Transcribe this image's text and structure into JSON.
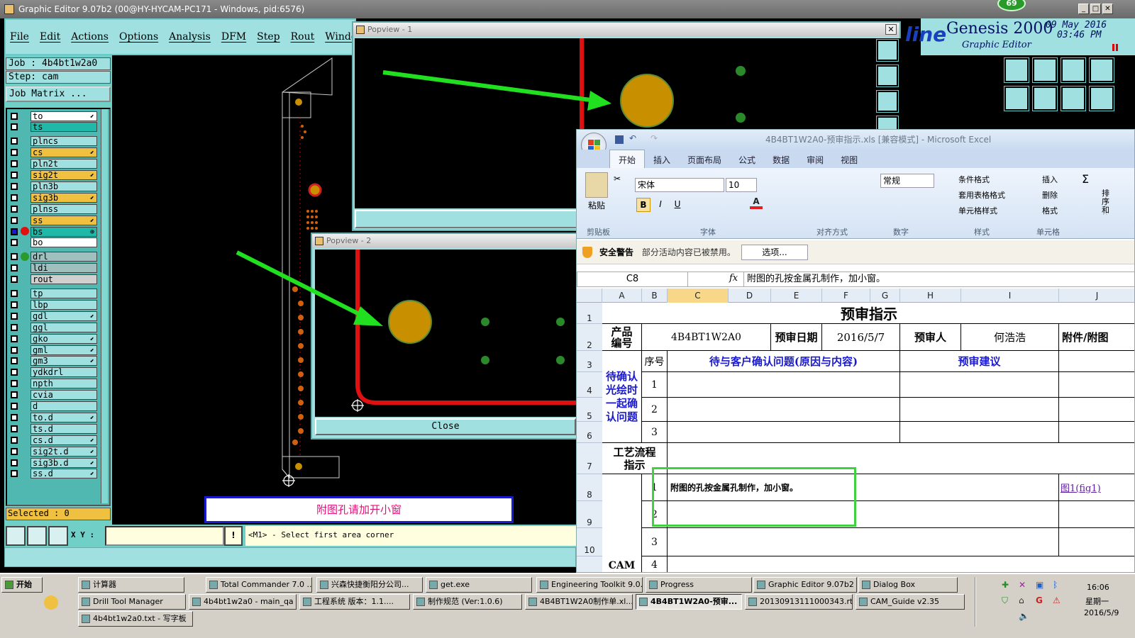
{
  "ge_window": {
    "title": "Graphic Editor 9.07b2 (00@HY-HYCAM-PC171 - Windows, pid:6576)",
    "badge": "69"
  },
  "menu": [
    "File",
    "Edit",
    "Actions",
    "Options",
    "Analysis",
    "DFM",
    "Step",
    "Rout",
    "Windows"
  ],
  "genesis": {
    "brand": "line",
    "product": "Genesis 2000",
    "subtitle": "Graphic Editor",
    "date": "09 May 2016",
    "time": "03:46 PM"
  },
  "job": {
    "job_label": "Job : 4b4bt1w2a0",
    "step_label": "Step: cam",
    "matrix_label": "Job Matrix ..."
  },
  "layers": [
    {
      "name": "to",
      "color": "#ffffff",
      "mark": "⬋"
    },
    {
      "name": "ts",
      "color": "#20b8a8",
      "mark": ""
    },
    {
      "name": "plncs",
      "color": "#a0e0e0",
      "mark": ""
    },
    {
      "name": "cs",
      "color": "#f0c040",
      "mark": "⬋"
    },
    {
      "name": "pln2t",
      "color": "#a0e0e0",
      "mark": ""
    },
    {
      "name": "sig2t",
      "color": "#f0c040",
      "mark": "⬋"
    },
    {
      "name": "pln3b",
      "color": "#a0e0e0",
      "mark": ""
    },
    {
      "name": "sig3b",
      "color": "#f0c040",
      "mark": "⬋"
    },
    {
      "name": "plnss",
      "color": "#a0e0e0",
      "mark": ""
    },
    {
      "name": "ss",
      "color": "#f0c040",
      "mark": "⬋"
    },
    {
      "name": "bs",
      "color": "#20b8a8",
      "mark": "⊕"
    },
    {
      "name": "bo",
      "color": "#ffffff",
      "mark": ""
    },
    {
      "name": "drl",
      "color": "#a0c0c0",
      "mark": ""
    },
    {
      "name": "ldi",
      "color": "#a0c0c0",
      "mark": ""
    },
    {
      "name": "rout",
      "color": "#d0d0d0",
      "mark": ""
    },
    {
      "name": "tp",
      "color": "#a0e0e0",
      "mark": ""
    },
    {
      "name": "lbp",
      "color": "#a0e0e0",
      "mark": ""
    },
    {
      "name": "gdl",
      "color": "#a0e0e0",
      "mark": "⬋"
    },
    {
      "name": "ggl",
      "color": "#a0e0e0",
      "mark": ""
    },
    {
      "name": "gko",
      "color": "#a0e0e0",
      "mark": "⬋"
    },
    {
      "name": "gml",
      "color": "#a0e0e0",
      "mark": "⬋"
    },
    {
      "name": "gm3",
      "color": "#a0e0e0",
      "mark": "⬋"
    },
    {
      "name": "ydkdrl",
      "color": "#a0e0e0",
      "mark": ""
    },
    {
      "name": "npth",
      "color": "#a0e0e0",
      "mark": ""
    },
    {
      "name": "cvia",
      "color": "#a0e0e0",
      "mark": ""
    },
    {
      "name": "d",
      "color": "#a0e0e0",
      "mark": ""
    },
    {
      "name": "to.d",
      "color": "#a0e0e0",
      "mark": "⬋"
    },
    {
      "name": "ts.d",
      "color": "#a0e0e0",
      "mark": ""
    },
    {
      "name": "cs.d",
      "color": "#a0e0e0",
      "mark": "⬋"
    },
    {
      "name": "sig2t.d",
      "color": "#a0e0e0",
      "mark": "⬋"
    },
    {
      "name": "sig3b.d",
      "color": "#a0e0e0",
      "mark": "⬋"
    },
    {
      "name": "ss.d",
      "color": "#a0e0e0",
      "mark": "⬋"
    }
  ],
  "selected_label": "Selected : 0",
  "popview1": {
    "title": "Popview - 1"
  },
  "popview2": {
    "title": "Popview - 2",
    "close_label": "Close"
  },
  "annotation_text": "附图孔请加开小窗",
  "status": {
    "xy_label": "X Y :",
    "message": "<M1> - Select first area corner"
  },
  "excel": {
    "title": "4B4BT1W2A0-预审指示.xls  [兼容模式] - Microsoft Excel",
    "tabs": [
      "开始",
      "插入",
      "页面布局",
      "公式",
      "数据",
      "审阅",
      "视图"
    ],
    "clipboard": {
      "paste": "粘贴",
      "group": "剪贴板"
    },
    "font": {
      "name": "宋体",
      "size": "10",
      "group": "字体"
    },
    "align_group": "对齐方式",
    "number": {
      "format": "常规",
      "group": "数字"
    },
    "styles": {
      "items": [
        "条件格式",
        "套用表格格式",
        "单元格样式"
      ],
      "group": "样式"
    },
    "cells_grp": {
      "items": [
        "插入",
        "删除",
        "格式"
      ],
      "group": "单元格"
    },
    "editing": {
      "label": "排序和筛选"
    },
    "security": {
      "title": "安全警告",
      "text": "部分活动内容已被禁用。",
      "button": "选项..."
    },
    "namebox": "C8",
    "formula": "附图的孔按金属孔制作，加小窗。",
    "columns": [
      "A",
      "B",
      "C",
      "D",
      "E",
      "F",
      "G",
      "H",
      "I",
      "J"
    ],
    "rows": [
      "1",
      "2",
      "3",
      "4",
      "5",
      "6",
      "7",
      "8",
      "9",
      "10"
    ],
    "sheet": {
      "title": "预审指示",
      "product_label": "产品编号",
      "product_value": "4B4BT1W2A0",
      "date_label": "预审日期",
      "date_value": "2016/5/7",
      "reviewer_label": "预审人",
      "reviewer_value": "何浩浩",
      "attachment_label": "附件/附图",
      "seq_label": "序号",
      "issue_header": "待与客户确认问题(原因与内容)",
      "suggest_header": "预审建议",
      "pending_label": "待确认光绘时一起确认问题",
      "process_label": "工艺流程指示",
      "cam_label": "CAM",
      "n1": "1",
      "n2": "2",
      "n3": "3",
      "n4": "4",
      "c8_text": "附图的孔按金属孔制作，加小窗。",
      "link": "图1(fig1)"
    }
  },
  "taskbar": {
    "start": "开始",
    "row1": [
      "计算器",
      "Total Commander 7.0 ...",
      "兴森快捷衡阳分公司...",
      "get.exe",
      "Engineering Toolkit 9.0...",
      "Progress",
      "Graphic Editor 9.07b2 (...",
      "Dialog Box"
    ],
    "row2": [
      "Drill Tool Manager",
      "4b4bt1w2a0 - main_qa",
      "工程系统  版本：1.1....",
      "制作规范 (Ver:1.0.6)",
      "4B4BT1W2A0制作单.xl...",
      "4B4BT1W2A0-预审...",
      "20130913111000343.rt...",
      "CAM_Guide v2.35"
    ],
    "row3": [
      "4b4bt1w2a0.txt - 写字板"
    ],
    "clock": "16:06",
    "weekday": "星期一",
    "date": "2016/5/9"
  }
}
